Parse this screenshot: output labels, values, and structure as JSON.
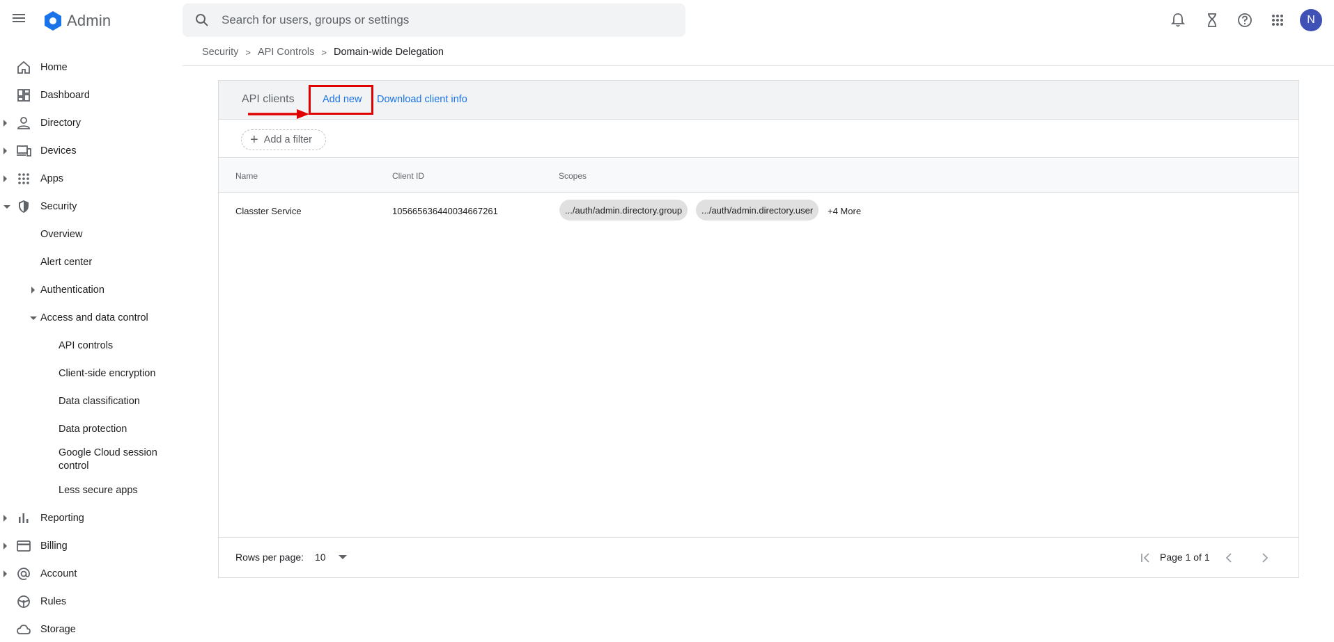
{
  "header": {
    "app_name": "Admin",
    "search_placeholder": "Search for users, groups or settings",
    "avatar_initial": "N",
    "accent_color": "#1a73e8",
    "avatar_color": "#3f51b5"
  },
  "breadcrumb": {
    "items": [
      "Security",
      "API Controls"
    ],
    "current": "Domain-wide Delegation"
  },
  "sidebar": {
    "items": [
      {
        "label": "Home",
        "icon": "home-icon"
      },
      {
        "label": "Dashboard",
        "icon": "dashboard-icon"
      },
      {
        "label": "Directory",
        "icon": "person-icon"
      },
      {
        "label": "Devices",
        "icon": "devices-icon"
      },
      {
        "label": "Apps",
        "icon": "apps-grid-icon"
      },
      {
        "label": "Security",
        "icon": "shield-icon"
      },
      {
        "label": "Overview"
      },
      {
        "label": "Alert center"
      },
      {
        "label": "Authentication"
      },
      {
        "label": "Access and data control"
      },
      {
        "label": "API controls"
      },
      {
        "label": "Client-side encryption"
      },
      {
        "label": "Data classification"
      },
      {
        "label": "Data protection"
      },
      {
        "label": "Google Cloud session control"
      },
      {
        "label": "Less secure apps"
      },
      {
        "label": "Reporting",
        "icon": "bar-chart-icon"
      },
      {
        "label": "Billing",
        "icon": "credit-card-icon"
      },
      {
        "label": "Account",
        "icon": "at-sign-icon"
      },
      {
        "label": "Rules",
        "icon": "steering-icon"
      },
      {
        "label": "Storage",
        "icon": "cloud-icon"
      }
    ]
  },
  "card": {
    "title": "API clients",
    "add_new": "Add new",
    "download": "Download client info",
    "filter": "Add a filter",
    "columns": [
      "Name",
      "Client ID",
      "Scopes"
    ],
    "rows": [
      {
        "name": "Classter Service",
        "client_id": "105665636440034667261",
        "scopes": [
          ".../auth/admin.directory.group",
          ".../auth/admin.directory.user"
        ],
        "more": "+4 More"
      }
    ],
    "rows_per_page_label": "Rows per page:",
    "rows_per_page_value": "10",
    "page_label": "Page 1 of 1"
  }
}
